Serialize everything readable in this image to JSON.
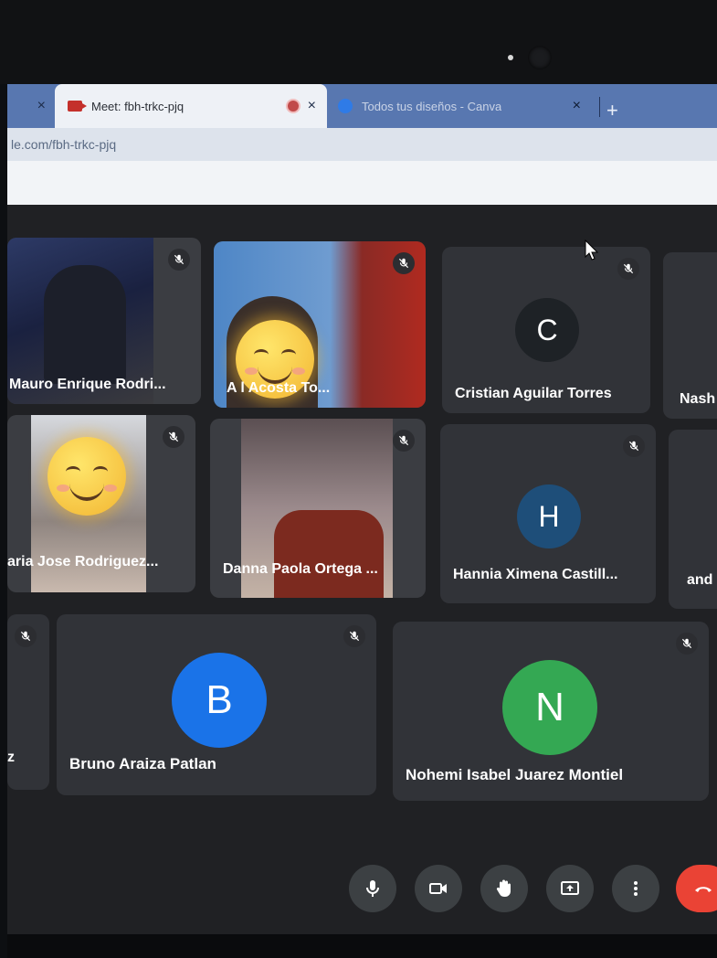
{
  "browser": {
    "tabs": [
      {
        "title": "",
        "close": "×"
      },
      {
        "title": "Meet: fbh-trkc-pjq",
        "close": "×"
      },
      {
        "title": "Todos tus diseños - Canva",
        "close": "×"
      }
    ],
    "new_tab": "+",
    "address": "le.com/fbh-trkc-pjq"
  },
  "participants": [
    {
      "name": "Mauro Enrique Rodri...",
      "muted": true,
      "kind": "video"
    },
    {
      "name": "A         l Acosta To...",
      "muted": true,
      "kind": "video"
    },
    {
      "name": "Cristian Aguilar Torres",
      "initial": "C",
      "avatar_color": "#1e2226",
      "muted": true,
      "kind": "avatar"
    },
    {
      "name": "Nash",
      "muted": false,
      "kind": "partial"
    },
    {
      "name": "aria Jose Rodriguez...",
      "muted": true,
      "kind": "video"
    },
    {
      "name": "Danna Paola Ortega ...",
      "muted": true,
      "kind": "video"
    },
    {
      "name": "Hannia Ximena Castill...",
      "initial": "H",
      "avatar_color": "#1e4e79",
      "muted": true,
      "kind": "avatar"
    },
    {
      "name": "and",
      "muted": false,
      "kind": "partial"
    },
    {
      "name": "z",
      "muted": true,
      "kind": "partial"
    },
    {
      "name": "Bruno Araiza Patlan",
      "initial": "B",
      "avatar_color": "#1a73e8",
      "muted": true,
      "kind": "avatar"
    },
    {
      "name": "Nohemi Isabel Juarez Montiel",
      "initial": "N",
      "avatar_color": "#34a853",
      "muted": true,
      "kind": "avatar"
    }
  ],
  "controls": {
    "items": [
      "mic-icon",
      "camera-icon",
      "raise-hand-icon",
      "present-screen-icon",
      "more-options-icon",
      "end-call-icon"
    ],
    "end_call_color": "#ea4335"
  }
}
